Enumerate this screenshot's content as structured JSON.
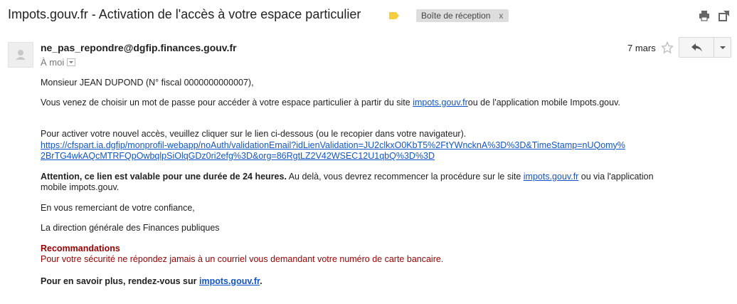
{
  "header": {
    "subject": "Impots.gouv.fr - Activation de l'accès à votre espace particulier",
    "label": "Boîte de réception",
    "label_close": "x"
  },
  "message": {
    "sender": "ne_pas_repondre@dgfip.finances.gouv.fr",
    "to": "À moi",
    "date": "7 mars"
  },
  "body": {
    "greeting": "Monsieur JEAN DUPOND (N° fiscal 0000000000007),",
    "p1_before": "Vous venez de choisir un mot de passe pour accéder à votre espace particulier à partir du site ",
    "p1_link": "impots.gouv.fr",
    "p1_after": "ou de l'application mobile Impots.gouv.",
    "p2": "Pour activer votre nouvel accès, veuillez cliquer sur le lien ci-dessous (ou le recopier dans votre navigateur).",
    "activation_link_line1": "https://cfspart.ia.dgfip/monprofil-webapp/noAuth/validationEmail?idLienValidation=JU2clkxO0KbT5%2FtYWncknA%3D%3D&TimeStamp=nUQomy%",
    "activation_link_line2": "2BrTG4wkAQcMTRFQpOwbqlpSiOlqGDz0ri2efg%3D&org=86RgtLZ2V42WSEC12U1qbQ%3D%3D",
    "p3_bold": "Attention, ce lien est valable pour une durée de 24 heures.",
    "p3_mid": " Au delà, vous devrez recommencer la procédure sur le site ",
    "p3_link": "impots.gouv.fr",
    "p3_after": " ou via l'application",
    "p3_line2": "mobile impots.gouv.",
    "thanks": "En vous remerciant de votre confiance,",
    "signature": "La direction générale des Finances publiques",
    "reco_title": "Recommandations",
    "reco_text": "Pour votre sécurité ne répondez jamais à un courriel vous demandant votre numéro de carte bancaire.",
    "final_before": "Pour en savoir plus, rendez-vous sur ",
    "final_link": "impots.gouv.fr",
    "final_after": "."
  },
  "colors": {
    "link": "#1155cc",
    "warning_red": "#990000",
    "label_tag": "#f5cf3f"
  },
  "icons": [
    "label-tag-icon",
    "print-icon",
    "new-window-icon",
    "avatar-icon",
    "star-icon",
    "reply-icon",
    "chevron-down-icon"
  ]
}
